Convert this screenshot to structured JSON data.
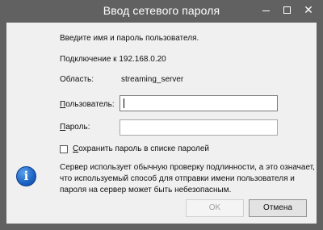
{
  "window": {
    "title": "Ввод сетевого пароля",
    "controls": {
      "minimize_icon": "minimize-icon",
      "maximize_icon": "maximize-icon",
      "close_glyph": "✕"
    }
  },
  "dialog": {
    "prompt": "Введите имя и пароль пользователя.",
    "connection": "Подключение к 192.168.0.20",
    "area_label": "Область:",
    "area_value": "streaming_server",
    "username_label": "Пользователь:",
    "username_value": "",
    "password_label": "Пароль:",
    "password_value": "",
    "save_password_label": "Сохранить пароль в списке паролей",
    "save_password_checked": false,
    "info_icon_glyph": "i",
    "info_lines": [
      "Сервер использует обычную проверку подлинности, а это означает,",
      "что используемый способ для отправки имени пользователя и",
      "пароля на сервер может быть небезопасным."
    ],
    "ok_label": "OK",
    "ok_enabled": false,
    "cancel_label": "Отмена"
  },
  "colors": {
    "titlebar": "#616161",
    "client_bg": "#f0f0f0",
    "info_icon": "#1c62c4"
  }
}
